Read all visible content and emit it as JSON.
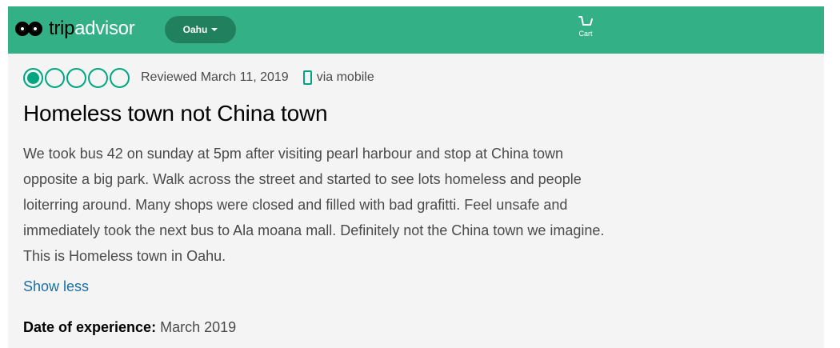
{
  "header": {
    "brand_trip": "trip",
    "brand_advisor": "advisor",
    "region_label": "Oahu",
    "cart_label": "Cart"
  },
  "review": {
    "rating": 1,
    "rating_max": 5,
    "reviewed_date": "Reviewed March 11, 2019",
    "via": "via mobile",
    "title": "Homeless town not China town",
    "body_lines": [
      "We took bus 42 on sunday at 5pm after visiting pearl harbour and stop at China town",
      "opposite a big park. Walk across the street and started to see lots homeless and people",
      "loiterring around. Many shops were closed and filled with bad grafitti. Feel unsafe and",
      "immediately took the next bus to Ala moana mall. Definitely not the China town we imagine.",
      "This is Homeless town in Oahu."
    ],
    "show_less": "Show less",
    "experience_label": "Date of experience:",
    "experience_value": "March 2019"
  },
  "colors": {
    "header_bg": "#34b087",
    "region_pill": "#21815f",
    "bubble": "#00a680",
    "link": "#1a6fa3"
  },
  "icons": [
    "owl-logo-icon",
    "chevron-down-icon",
    "cart-icon",
    "rating-bubble-icon",
    "mobile-phone-icon"
  ]
}
